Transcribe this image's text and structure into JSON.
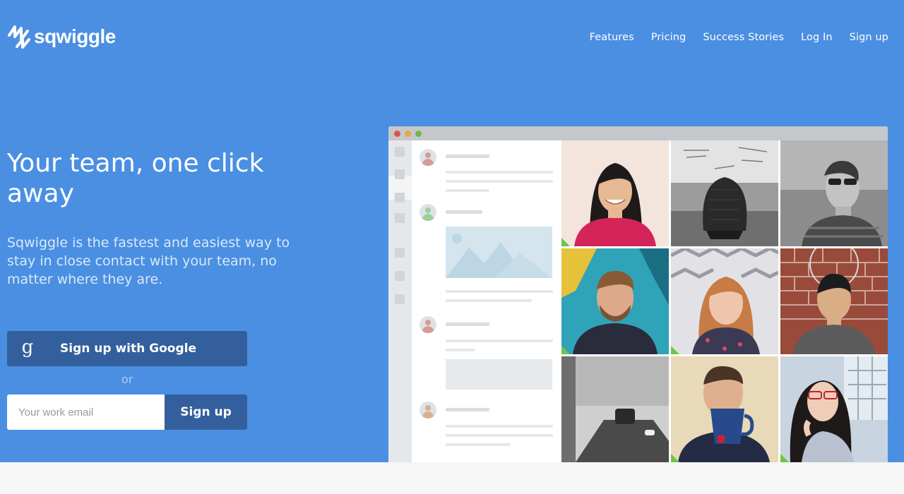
{
  "brand": {
    "name": "sqwiggle"
  },
  "nav": {
    "items": [
      {
        "label": "Features"
      },
      {
        "label": "Pricing"
      },
      {
        "label": "Success Stories"
      },
      {
        "label": "Log In"
      },
      {
        "label": "Sign up"
      }
    ]
  },
  "hero": {
    "headline": "Your team, one click away",
    "subheadline": "Sqwiggle is the fastest and easiest way to stay in close contact with your team, no matter where they are.",
    "google_button": {
      "icon": "g",
      "label": "Sign up with Google"
    },
    "or_text": "or",
    "email_field": {
      "value": "",
      "placeholder": "Your work email"
    },
    "signup_button": {
      "label": "Sign up"
    }
  },
  "mockup": {
    "window_dots": [
      "#e0534a",
      "#e7a93b",
      "#71b94a"
    ],
    "status_color": "#6cc644",
    "participants": [
      {
        "icon": "woman-smiling-photo"
      },
      {
        "icon": "empty-office-chair-photo"
      },
      {
        "icon": "man-sunglasses-photo"
      },
      {
        "icon": "man-beard-selfie-photo"
      },
      {
        "icon": "woman-red-hair-photo"
      },
      {
        "icon": "man-brick-wall-photo"
      },
      {
        "icon": "empty-meeting-room-photo"
      },
      {
        "icon": "man-drinking-mug-photo"
      },
      {
        "icon": "woman-glasses-photo"
      }
    ]
  },
  "colors": {
    "hero_background": "#4a8fe2",
    "button_primary": "#33609c",
    "page_background": "#f6f6f6"
  }
}
